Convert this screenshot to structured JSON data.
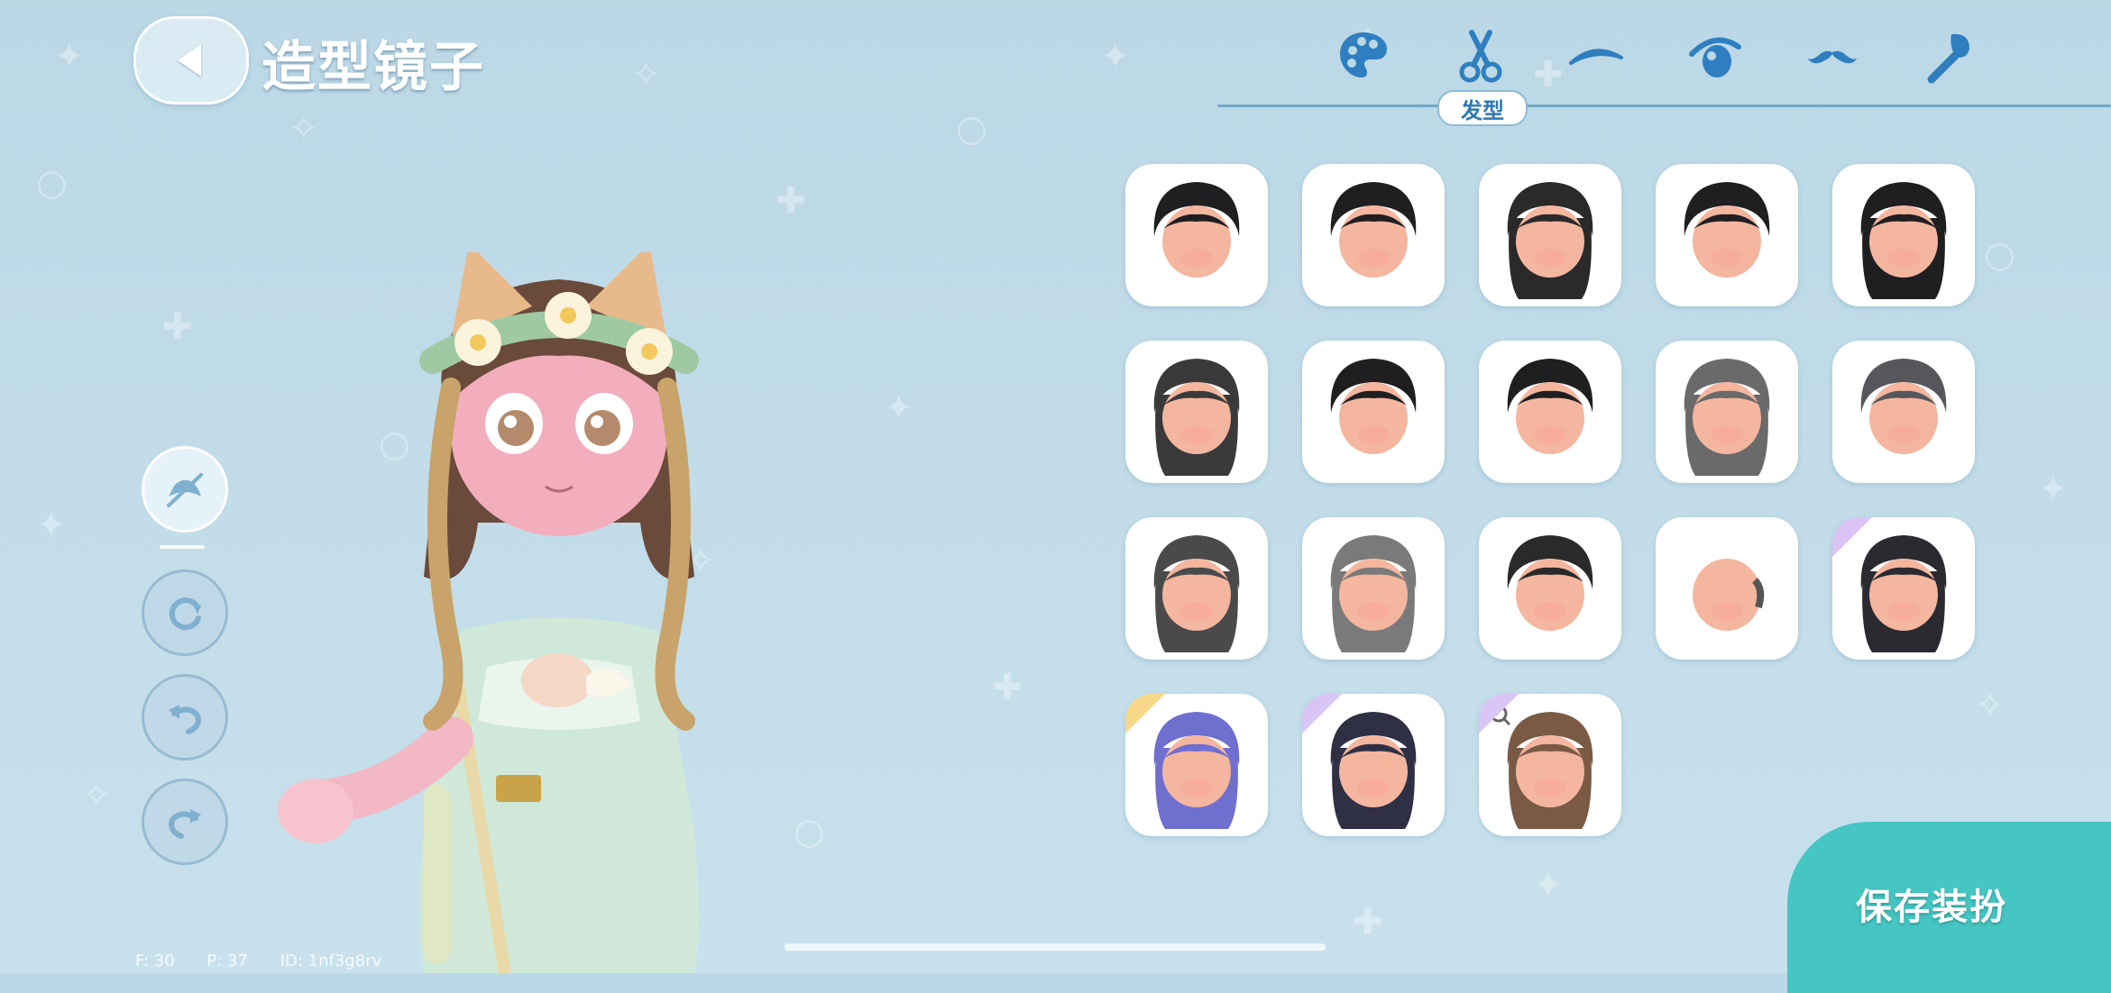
{
  "header": {
    "title": "造型镜子"
  },
  "tabs": [
    {
      "icon": "palette-icon"
    },
    {
      "icon": "scissors-icon",
      "label": "发型",
      "active": true
    },
    {
      "icon": "eyebrow-icon"
    },
    {
      "icon": "eye-icon"
    },
    {
      "icon": "mustache-icon"
    },
    {
      "icon": "makeup-brush-icon"
    }
  ],
  "tools": [
    {
      "icon": "hide-hat-icon",
      "active": true
    },
    {
      "icon": "rotate-icon"
    },
    {
      "icon": "undo-icon"
    },
    {
      "icon": "redo-icon"
    }
  ],
  "hair_items": [
    {
      "style": "short-spiky-ahoge",
      "color": "#1f1f22"
    },
    {
      "style": "bob-bangs",
      "color": "#1f1f22"
    },
    {
      "style": "bob-gradient",
      "color": "#2a2a2a"
    },
    {
      "style": "jacket-short",
      "color": "#1f1f22"
    },
    {
      "style": "long-straight",
      "color": "#1f1f22"
    },
    {
      "style": "long-gradient",
      "color": "#3a3a3a"
    },
    {
      "style": "high-ponytail",
      "color": "#1f1f22"
    },
    {
      "style": "short-neat",
      "color": "#1f1f22"
    },
    {
      "style": "medium-wavy-grey",
      "color": "#6a6a6a"
    },
    {
      "style": "curly-grey",
      "color": "#55575a"
    },
    {
      "style": "long-wavy-gradient",
      "color": "#4a4a4a"
    },
    {
      "style": "long-wavy-silver",
      "color": "#7a7a7a"
    },
    {
      "style": "straight-medium",
      "color": "#2a2a2a"
    },
    {
      "style": "bald",
      "color": "#555555"
    },
    {
      "style": "hime-purple-highlight",
      "color": "#2a2a30",
      "rarity": "purple"
    },
    {
      "style": "twin-buns-violet",
      "color": "#6f6fd0",
      "rarity": "gold"
    },
    {
      "style": "braided-dark-navy",
      "color": "#2f3044",
      "rarity": "purple"
    },
    {
      "style": "current-brown-twintail",
      "color": "#7a5a45",
      "rarity": "purple",
      "selected": true
    }
  ],
  "save_button": {
    "label": "保存装扮"
  },
  "debug": {
    "f": "F: 30",
    "p": "P: 37",
    "id": "ID: 1nf3g8rv"
  },
  "colors": {
    "accent": "#46c6c3",
    "tab_icon": "#2f7fc0",
    "bg": "#bcd8e6"
  }
}
